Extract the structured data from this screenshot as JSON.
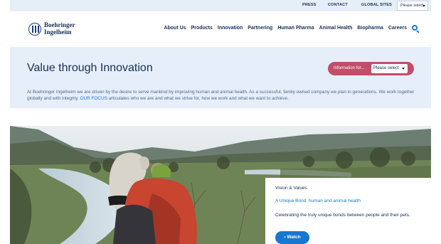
{
  "topbar": {
    "links": [
      "PRESS",
      "CONTACT",
      "GLOBAL SITES"
    ],
    "select_value": "Please select"
  },
  "header": {
    "logo_line1": "Boehringer",
    "logo_line2": "Ingelheim",
    "nav": [
      "About Us",
      "Products",
      "Innovation",
      "Partnering",
      "Human Pharma",
      "Animal Health",
      "Biopharma",
      "Careers"
    ]
  },
  "hero": {
    "title": "Value through Innovation",
    "info_label": "Information for...",
    "info_select": "Please select",
    "desc_before": "At Boehringer Ingelheim we are driven by the desire to serve mankind by improving human and animal health. As a successful, family owned company we plan in generations. We work together globally and with integrity. ",
    "desc_link": "OUR FOCUS",
    "desc_after": " articulates who we are and what we strive for, how we work and what we want to achieve."
  },
  "card": {
    "kicker": "Vision & Values",
    "link": "A Unique Bond: human and animal health",
    "text": "Celebrating the truly unique bonds between people and their pets.",
    "button": "› Watch"
  },
  "colors": {
    "navy": "#14305a",
    "accent": "#1877d2",
    "pill": "#c14e6a",
    "panel": "#e6eef9"
  }
}
